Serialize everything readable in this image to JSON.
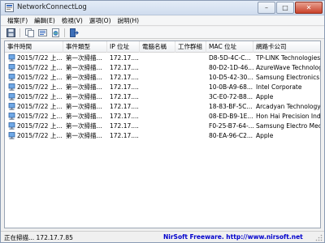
{
  "window": {
    "title": "NetworkConnectLog"
  },
  "titlebar_buttons": {
    "minimize": "–",
    "maximize": "□",
    "close": "✕"
  },
  "menu": {
    "items": [
      "檔案(F)",
      "編輯(E)",
      "檢視(V)",
      "選項(O)",
      "說明(H)"
    ]
  },
  "toolbar": {
    "icons": [
      "save-icon",
      "copy-icon",
      "properties-icon",
      "html-report-icon",
      "exit-icon"
    ]
  },
  "table": {
    "columns": [
      "事件時間",
      "事件類型",
      "IP 位址",
      "電腦名稱",
      "工作群組",
      "MAC 位址",
      "網路卡公司"
    ],
    "rows": [
      [
        "2015/7/22 上...",
        "第一次掃描...",
        "172.17....",
        "",
        "",
        "D8-5D-4C-C...",
        "TP-LINK Technologies ..."
      ],
      [
        "2015/7/22 上...",
        "第一次掃描...",
        "172.17....",
        "",
        "",
        "80-D2-1D-46...",
        "AzureWave Technolog..."
      ],
      [
        "2015/7/22 上...",
        "第一次掃描...",
        "172.17....",
        "",
        "",
        "10-D5-42-30...",
        "Samsung Electronics C..."
      ],
      [
        "2015/7/22 上...",
        "第一次掃描...",
        "172.17....",
        "",
        "",
        "10-0B-A9-68...",
        "Intel Corporate"
      ],
      [
        "2015/7/22 上...",
        "第一次掃描...",
        "172.17....",
        "",
        "",
        "3C-E0-72-B8...",
        "Apple"
      ],
      [
        "2015/7/22 上...",
        "第一次掃描...",
        "172.17....",
        "",
        "",
        "18-83-BF-5C...",
        "Arcadyan Technology ..."
      ],
      [
        "2015/7/22 上...",
        "第一次掃描...",
        "172.17....",
        "",
        "",
        "08-ED-B9-1E...",
        "Hon Hai Precision Ind..."
      ],
      [
        "2015/7/22 上...",
        "第一次掃描...",
        "172.17....",
        "",
        "",
        "F0-25-B7-64-...",
        "Samsung Electro Mech..."
      ],
      [
        "2015/7/22 上...",
        "第一次掃描...",
        "172.17....",
        "",
        "",
        "80-EA-96-C2...",
        "Apple"
      ]
    ]
  },
  "statusbar": {
    "left": "正在掃描... 172.17.7.85",
    "right": "NirSoft Freeware.  http://www.nirsoft.net"
  },
  "colors": {
    "close_button": "#c9422a",
    "link_text": "#0000cc",
    "title_gradient_top": "#e4ecf7"
  }
}
